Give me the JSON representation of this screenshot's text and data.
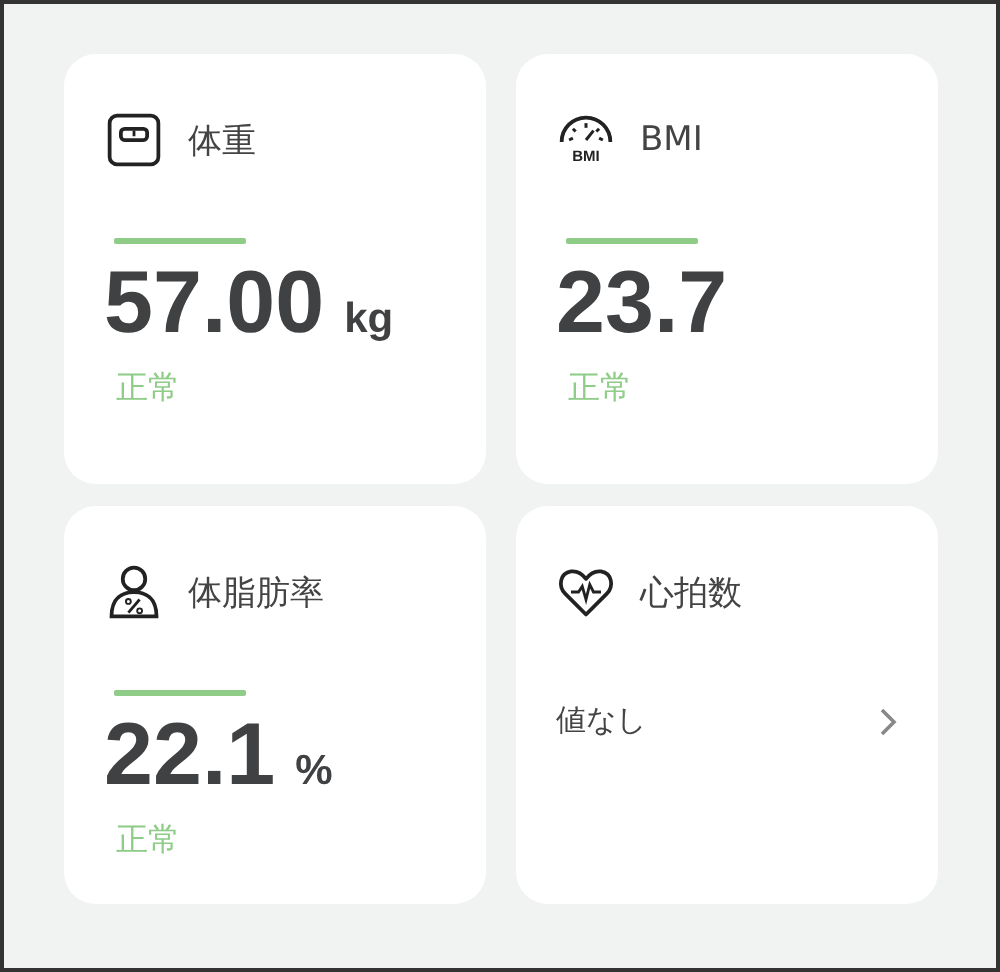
{
  "cards": [
    {
      "kind": "metric",
      "title": "体重",
      "value": "57.00",
      "unit": "kg",
      "status": {
        "label": "正常",
        "color": "#8fcc88"
      }
    },
    {
      "kind": "metric",
      "icon_text": "BMI",
      "title": "BMI",
      "value": "23.7",
      "status": {
        "label": "正常",
        "color": "#8fcc88"
      }
    },
    {
      "kind": "metric",
      "title": "体脂肪率",
      "value": "22.1",
      "unit": "%",
      "status": {
        "label": "正常",
        "color": "#8fcc88"
      }
    },
    {
      "kind": "empty",
      "title": "心拍数",
      "message": "値なし"
    }
  ]
}
